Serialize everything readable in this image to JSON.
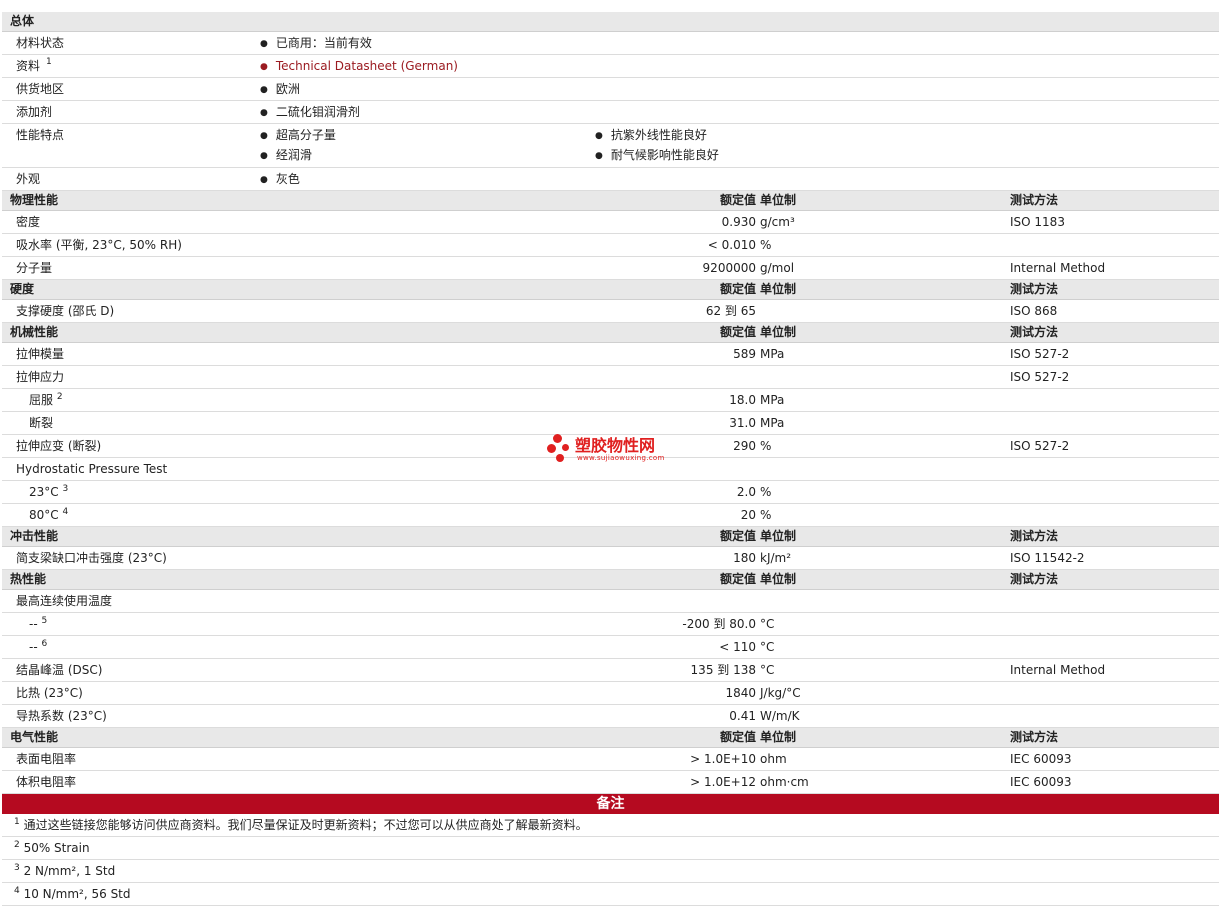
{
  "general": {
    "title": "总体",
    "rows": [
      {
        "label": "材料状态",
        "items": [
          "已商用：当前有效"
        ]
      },
      {
        "label": "资料",
        "sup": "1",
        "items": [
          "Technical Datasheet (German)"
        ],
        "link": true
      },
      {
        "label": "供货地区",
        "items": [
          "欧洲"
        ]
      },
      {
        "label": "添加剂",
        "items": [
          "二硫化钼润滑剂"
        ]
      },
      {
        "label": "性能特点",
        "items": [
          "超高分子量",
          "抗紫外线性能良好",
          "经润滑",
          "耐气候影响性能良好"
        ]
      },
      {
        "label": "外观",
        "items": [
          "灰色"
        ]
      }
    ]
  },
  "headers": {
    "value": "额定值",
    "unit": "单位制",
    "method": "测试方法"
  },
  "sections": [
    {
      "title": "物理性能",
      "rows": [
        {
          "label": "密度",
          "value": "0.930",
          "unit": "g/cm³",
          "method": "ISO 1183"
        },
        {
          "label": "吸水率 (平衡, 23°C, 50% RH)",
          "value": "< 0.010",
          "unit": "%",
          "method": ""
        },
        {
          "label": "分子量",
          "value": "9200000",
          "unit": "g/mol",
          "method": "Internal Method"
        }
      ]
    },
    {
      "title": "硬度",
      "rows": [
        {
          "label": "支撑硬度 (邵氏 D)",
          "value": "62 到  65",
          "unit": "",
          "method": "ISO 868"
        }
      ]
    },
    {
      "title": "机械性能",
      "rows": [
        {
          "label": "拉伸模量",
          "value": "589",
          "unit": "MPa",
          "method": "ISO 527-2"
        },
        {
          "label": "拉伸应力",
          "value": "",
          "unit": "",
          "method": "ISO 527-2"
        },
        {
          "label": "屈服",
          "sup": "2",
          "indent": true,
          "value": "18.0",
          "unit": "MPa",
          "method": ""
        },
        {
          "label": "断裂",
          "indent": true,
          "value": "31.0",
          "unit": "MPa",
          "method": ""
        },
        {
          "label": "拉伸应变 (断裂)",
          "value": "290",
          "unit": "%",
          "method": "ISO 527-2"
        },
        {
          "label": "Hydrostatic Pressure Test",
          "value": "",
          "unit": "",
          "method": ""
        },
        {
          "label": "23°C",
          "sup": "3",
          "indent": true,
          "value": "2.0",
          "unit": "%",
          "method": ""
        },
        {
          "label": "80°C",
          "sup": "4",
          "indent": true,
          "value": "20",
          "unit": "%",
          "method": ""
        }
      ]
    },
    {
      "title": "冲击性能",
      "rows": [
        {
          "label": "简支梁缺口冲击强度 (23°C)",
          "value": "180",
          "unit": "kJ/m²",
          "method": "ISO 11542-2"
        }
      ]
    },
    {
      "title": "热性能",
      "rows": [
        {
          "label": "最高连续使用温度",
          "value": "",
          "unit": "",
          "method": ""
        },
        {
          "label": "--",
          "sup": "5",
          "indent": true,
          "value": "-200 到  80.0",
          "unit": "°C",
          "method": ""
        },
        {
          "label": "--",
          "sup": "6",
          "indent": true,
          "value": "< 110",
          "unit": "°C",
          "method": ""
        },
        {
          "label": "结晶峰温 (DSC)",
          "value": "135 到  138",
          "unit": "°C",
          "method": "Internal Method"
        },
        {
          "label": "比热 (23°C)",
          "value": "1840",
          "unit": "J/kg/°C",
          "method": ""
        },
        {
          "label": "导热系数 (23°C)",
          "value": "0.41",
          "unit": "W/m/K",
          "method": ""
        }
      ]
    },
    {
      "title": "电气性能",
      "rows": [
        {
          "label": "表面电阻率",
          "value": "> 1.0E+10",
          "unit": "ohm",
          "method": "IEC 60093"
        },
        {
          "label": "体积电阻率",
          "value": "> 1.0E+12",
          "unit": "ohm·cm",
          "method": "IEC 60093"
        }
      ]
    }
  ],
  "notes": {
    "title": "备注",
    "items": [
      {
        "n": "1",
        "text": "通过这些链接您能够访问供应商资料。我们尽量保证及时更新资料；不过您可以从供应商处了解最新资料。"
      },
      {
        "n": "2",
        "text": "50% Strain"
      },
      {
        "n": "3",
        "text": "2 N/mm², 1 Std"
      },
      {
        "n": "4",
        "text": "10 N/mm², 56 Std"
      }
    ]
  },
  "watermark": {
    "name": "塑胶物性网",
    "url": "www.sujiaowuxing.com"
  },
  "colors": {
    "accent": "#b50a20",
    "link": "#9b1b21",
    "section_bg": "#e8e8e8"
  }
}
